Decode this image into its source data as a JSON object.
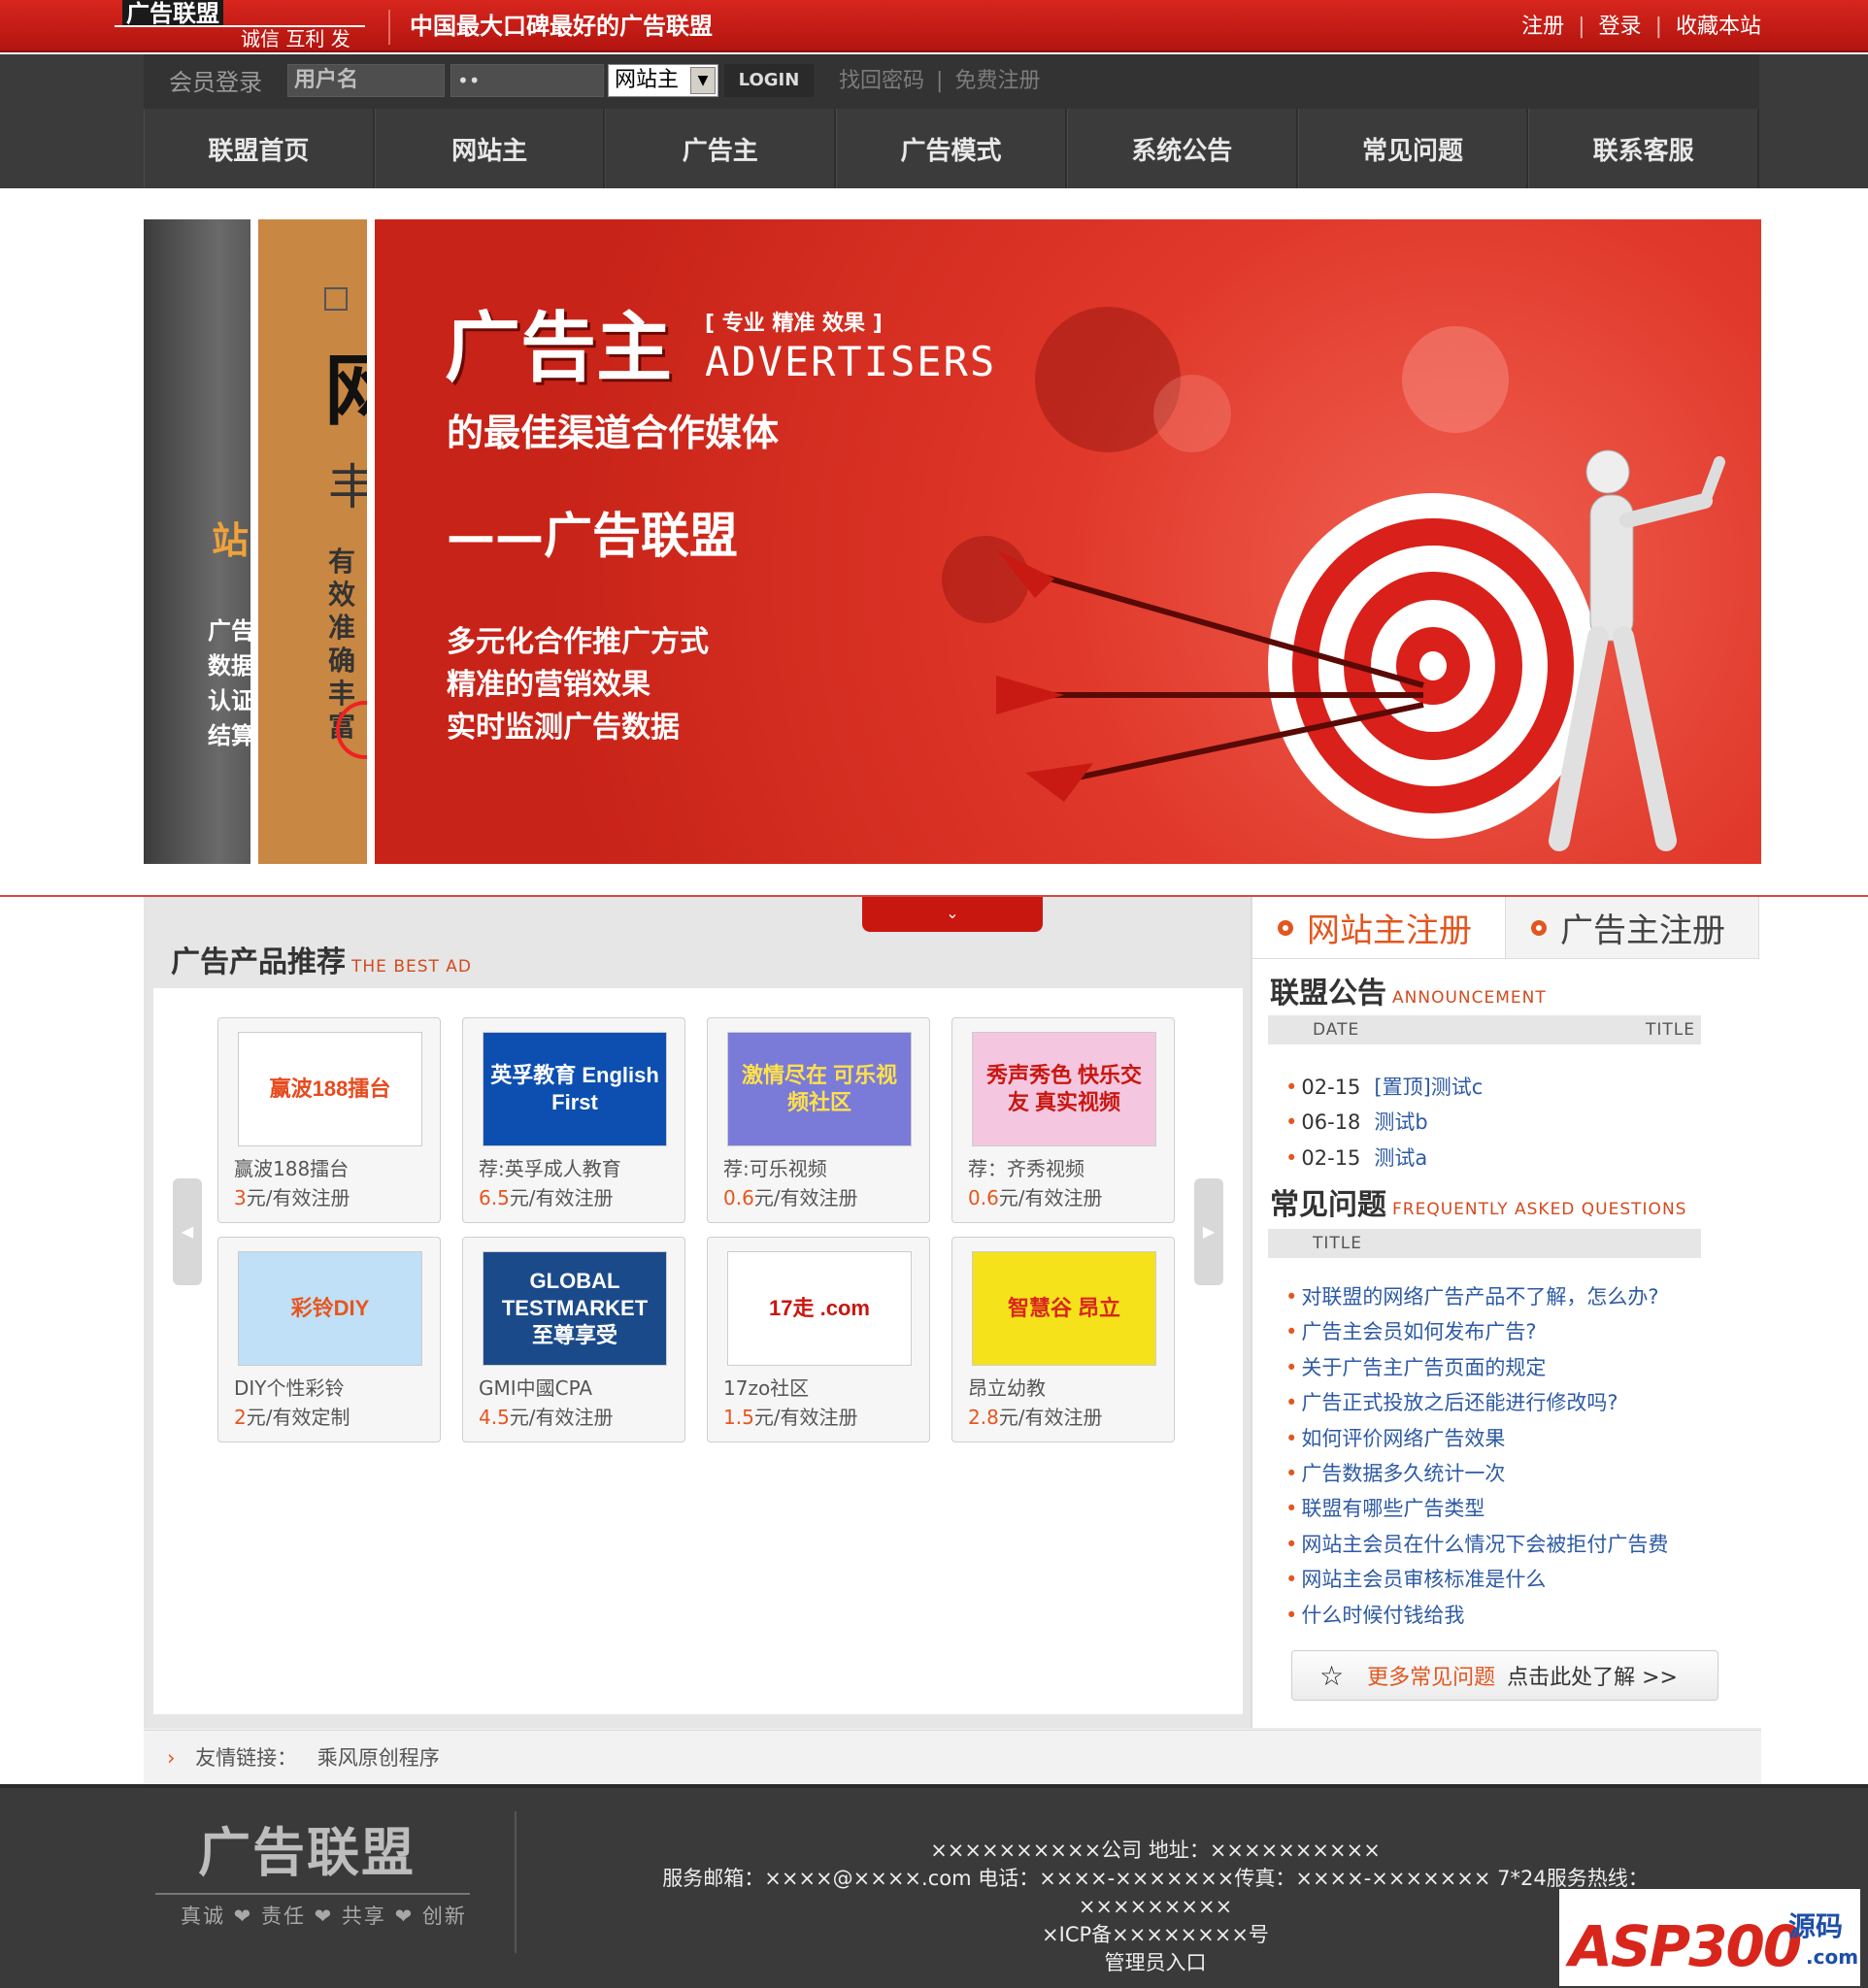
{
  "header": {
    "logo_main": "广告联盟",
    "logo_sub": "诚信 互利 发展",
    "slogan": "中国最大口碑最好的广告联盟",
    "links": [
      "注册",
      "登录",
      "收藏本站"
    ]
  },
  "login": {
    "label": "会员登录",
    "username_value": "用户名",
    "password_value": "••",
    "role_selected": "网站主",
    "submit_label": "LOGIN",
    "links": [
      "找回密码",
      "免费注册"
    ]
  },
  "nav": [
    "联盟首页",
    "网站主",
    "广告主",
    "广告模式",
    "系统公告",
    "常见问题",
    "联系客服"
  ],
  "banner": {
    "side_gray": {
      "title": "站",
      "lines": "广告数据认证结算"
    },
    "side_orange": {
      "big": "网",
      "mid": "丰",
      "lines": "有效准确丰富"
    },
    "title": "广告主",
    "tag": "[ 专业 精准 效果 ]",
    "title_en": "ADVERTISERS",
    "subtitle": "的最佳渠道合作媒体",
    "brand": "——广告联盟",
    "points": [
      "多元化合作推广方式",
      "精准的营销效果",
      "实时监测广告数据"
    ]
  },
  "products": {
    "title": "广告产品推荐",
    "title_en": "THE BEST AD",
    "items": [
      {
        "thumb": "赢波188擂台",
        "name": "赢波188擂台",
        "price_num": "3",
        "price_unit": "元/有效注册",
        "colors": [
          "#fff",
          "#e84a1e"
        ]
      },
      {
        "thumb": "英孚教育 English First",
        "name": "荐:英孚成人教育",
        "price_num": "6.5",
        "price_unit": "元/有效注册",
        "colors": [
          "#0d4fb0",
          "#ffffff"
        ]
      },
      {
        "thumb": "激情尽在 可乐视频社区",
        "name": "荐:可乐视频",
        "price_num": "0.6",
        "price_unit": "元/有效注册",
        "colors": [
          "#7a7ad8",
          "#ffe14a"
        ]
      },
      {
        "thumb": "秀声秀色 快乐交友 真实视频",
        "name": "荐：齐秀视频",
        "price_num": "0.6",
        "price_unit": "元/有效注册",
        "colors": [
          "#f4c6e0",
          "#c8170f"
        ]
      },
      {
        "thumb": "彩铃DIY",
        "name": "DIY个性彩铃",
        "price_num": "2",
        "price_unit": "元/有效定制",
        "colors": [
          "#bfe0f6",
          "#e8551e"
        ]
      },
      {
        "thumb": "GLOBAL TESTMARKET 至尊享受",
        "name": "GMI中國CPA",
        "price_num": "4.5",
        "price_unit": "元/有效注册",
        "colors": [
          "#1a4a8a",
          "#ffffff"
        ]
      },
      {
        "thumb": "17走 .com",
        "name": "17zo社区",
        "price_num": "1.5",
        "price_unit": "元/有效注册",
        "colors": [
          "#ffffff",
          "#c8170f"
        ]
      },
      {
        "thumb": "智慧谷 昂立",
        "name": "昂立幼教",
        "price_num": "2.8",
        "price_unit": "元/有效注册",
        "colors": [
          "#f6e21a",
          "#d8261c"
        ]
      }
    ],
    "pull_tab": "⌄"
  },
  "register_tabs": [
    "网站主注册",
    "广告主注册"
  ],
  "announcement": {
    "title": "联盟公告",
    "title_en": "ANNOUNCEMENT",
    "col_date": "DATE",
    "col_title": "TITLE",
    "items": [
      {
        "date": "02-15",
        "title": "[置顶]测试c"
      },
      {
        "date": "06-18",
        "title": "测试b"
      },
      {
        "date": "02-15",
        "title": "测试a"
      }
    ]
  },
  "faq": {
    "title": "常见问题",
    "title_en": "FREQUENTLY ASKED QUESTIONS",
    "col_title": "TITLE",
    "items": [
      "对联盟的网络广告产品不了解，怎么办?",
      "广告主会员如何发布广告?",
      "关于广告主广告页面的规定",
      "广告正式投放之后还能进行修改吗?",
      "如何评价网络广告效果",
      "广告数据多久统计一次",
      "联盟有哪些广告类型",
      "网站主会员在什么情况下会被拒付广告费",
      "网站主会员审核标准是什么",
      "什么时候付钱给我"
    ],
    "more_highlight": "更多常见问题",
    "more_text": "点击此处了解 >>"
  },
  "friends": {
    "label": "友情链接：",
    "links": [
      "乘风原创程序"
    ]
  },
  "footer": {
    "logo": "广告联盟",
    "motto": "真诚 ❤ 责任 ❤ 共享 ❤ 创新",
    "line1": "××××××××××公司 地址：××××××××××",
    "line2": "服务邮箱：××××@××××.com 电话：××××-×××××××传真：××××-××××××× 7*24服务热线：",
    "line3": "×××××××××",
    "line4": "×ICP备××××××××号",
    "line5": "管理员入口",
    "badge_main": "ASP300",
    "badge_cn": "源码",
    "badge_com": ".com"
  }
}
